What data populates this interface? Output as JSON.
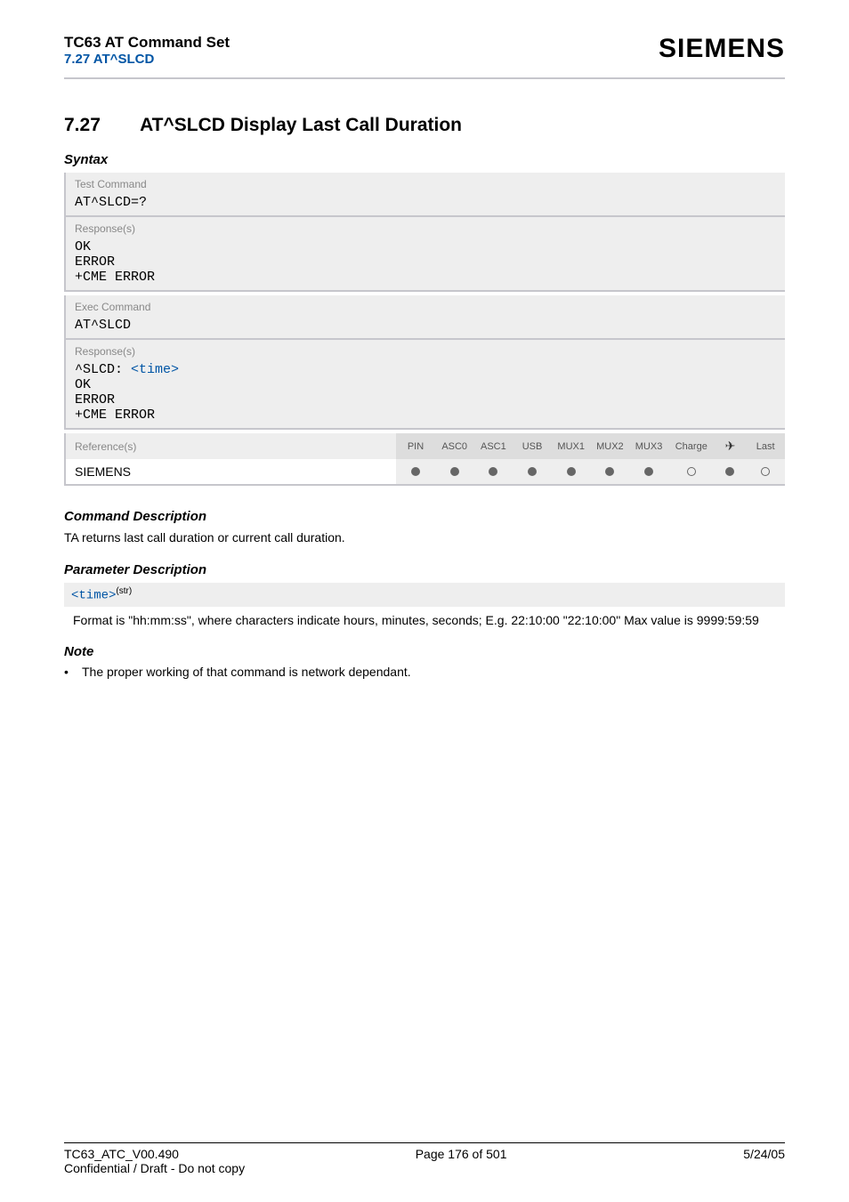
{
  "header": {
    "title": "TC63 AT Command Set",
    "subtitle": "7.27 AT^SLCD",
    "brand": "SIEMENS"
  },
  "section": {
    "number": "7.27",
    "title": "AT^SLCD   Display Last Call Duration"
  },
  "syntax": {
    "heading": "Syntax",
    "test_label": "Test Command",
    "test_cmd": "AT^SLCD=?",
    "resp_label": "Response(s)",
    "test_resp_lines": [
      "OK",
      "ERROR",
      "+CME ERROR"
    ],
    "exec_label": "Exec Command",
    "exec_cmd": "AT^SLCD",
    "exec_resp_prefix": "^SLCD: ",
    "exec_resp_param": "<time>",
    "exec_resp_rest": [
      "OK",
      "ERROR",
      "+CME ERROR"
    ]
  },
  "reference": {
    "label": "Reference(s)",
    "value": "SIEMENS",
    "columns": [
      "PIN",
      "ASC0",
      "ASC1",
      "USB",
      "MUX1",
      "MUX2",
      "MUX3",
      "Charge",
      "",
      "Last"
    ],
    "arrow_glyph": "✈",
    "states": [
      "filled",
      "filled",
      "filled",
      "filled",
      "filled",
      "filled",
      "filled",
      "empty",
      "filled",
      "empty"
    ]
  },
  "cmd_desc": {
    "heading": "Command Description",
    "text": "TA returns last call duration or current call duration."
  },
  "param_desc": {
    "heading": "Parameter Description",
    "name": "<time>",
    "type": "(str)",
    "text": "Format is \"hh:mm:ss\", where characters indicate hours, minutes, seconds; E.g. 22:10:00 \"22:10:00\" Max value is 9999:59:59"
  },
  "note": {
    "heading": "Note",
    "items": [
      "The proper working of that command is network dependant."
    ]
  },
  "footer": {
    "left": "TC63_ATC_V00.490",
    "center": "Page 176 of 501",
    "right": "5/24/05",
    "conf": "Confidential / Draft - Do not copy"
  }
}
